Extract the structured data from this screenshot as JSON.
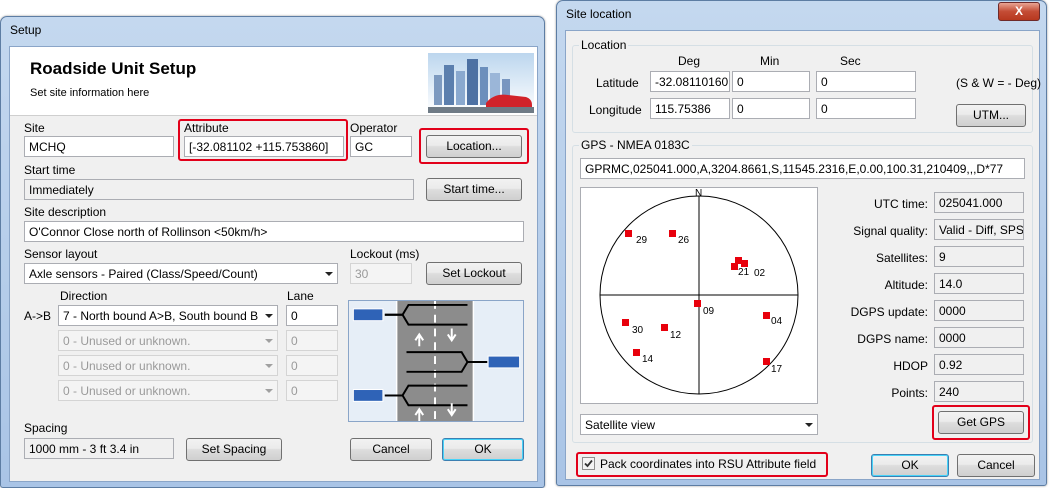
{
  "setup": {
    "title": "Setup",
    "header": {
      "title": "Roadside Unit Setup",
      "subtitle": "Set site information here"
    },
    "site": {
      "label": "Site",
      "value": "MCHQ"
    },
    "attribute": {
      "label": "Attribute",
      "value": "[-32.081102 +115.753860]"
    },
    "operator": {
      "label": "Operator",
      "value": "GC"
    },
    "location_button": "Location...",
    "start_time": {
      "label": "Start time",
      "value": "Immediately",
      "button": "Start time..."
    },
    "site_description": {
      "label": "Site description",
      "value": "O'Connor Close north of Rollinson <50km/h>"
    },
    "sensor_layout": {
      "label": "Sensor layout",
      "value": "Axle sensors - Paired (Class/Speed/Count)"
    },
    "lockout": {
      "label": "Lockout (ms)",
      "value": "30",
      "button": "Set Lockout"
    },
    "direction_header": "Direction",
    "lane_header": "Lane",
    "rows": [
      {
        "prefix": "A->B",
        "direction": "7 - North bound A>B, South bound B",
        "lane": "0",
        "enabled": true
      },
      {
        "prefix": "",
        "direction": "0 - Unused or unknown.",
        "lane": "0",
        "enabled": false
      },
      {
        "prefix": "",
        "direction": "0 - Unused or unknown.",
        "lane": "0",
        "enabled": false
      },
      {
        "prefix": "",
        "direction": "0 - Unused or unknown.",
        "lane": "0",
        "enabled": false
      }
    ],
    "spacing": {
      "label": "Spacing",
      "value": "1000 mm - 3 ft 3.4 in",
      "button": "Set Spacing"
    },
    "cancel": "Cancel",
    "ok": "OK"
  },
  "site_location": {
    "title": "Site location",
    "location_group": "Location",
    "col_deg": "Deg",
    "col_min": "Min",
    "col_sec": "Sec",
    "latitude": {
      "label": "Latitude",
      "deg": "-32.08110160",
      "min": "0",
      "sec": "0"
    },
    "longitude": {
      "label": "Longitude",
      "deg": "115.75386",
      "min": "0",
      "sec": "0"
    },
    "sw_note": "(S & W = - Deg)",
    "utm_button": "UTM...",
    "gps_group": "GPS - NMEA 0183C",
    "nmea": "GPRMC,025041.000,A,3204.8661,S,11545.2316,E,0.00,100.31,210409,,,D*77",
    "north_label": "N",
    "satellites": [
      "29",
      "26",
      "21",
      "02",
      "09",
      "04",
      "30",
      "12",
      "14",
      "17"
    ],
    "info": [
      {
        "label": "UTC time:",
        "value": "025041.000"
      },
      {
        "label": "Signal quality:",
        "value": "Valid - Diff, SPS"
      },
      {
        "label": "Satellites:",
        "value": "9"
      },
      {
        "label": "Altitude:",
        "value": "14.0"
      },
      {
        "label": "DGPS update:",
        "value": "0000"
      },
      {
        "label": "DGPS name:",
        "value": "0000"
      },
      {
        "label": "HDOP",
        "value": "0.92"
      },
      {
        "label": "Points:",
        "value": "240"
      }
    ],
    "view_select": "Satellite view",
    "get_gps": "Get GPS",
    "pack_checkbox": "Pack coordinates into RSU Attribute field",
    "pack_checked": true,
    "ok": "OK",
    "cancel": "Cancel",
    "close_glyph": "X"
  }
}
